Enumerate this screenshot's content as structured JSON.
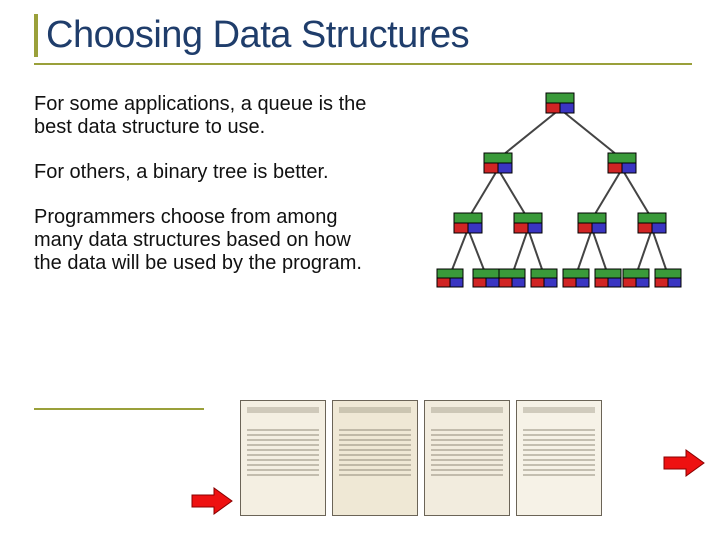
{
  "title": "Choosing Data Structures",
  "paragraphs": [
    "For some applications, a queue is the best data structure to use.",
    "For others, a binary tree is better.",
    "Programmers choose from among many data structures based on how the data will be used by the program."
  ],
  "tree": {
    "node_colors": [
      "#3a9a3a",
      "#d02424",
      "#3a35c2"
    ],
    "levels": 4
  },
  "icons": {
    "arrow_left": "arrow-right-icon",
    "arrow_right": "arrow-right-icon"
  },
  "documents": [
    {
      "label": "historical-document-1"
    },
    {
      "label": "historical-document-2"
    },
    {
      "label": "historical-document-3"
    },
    {
      "label": "historical-document-4"
    }
  ]
}
